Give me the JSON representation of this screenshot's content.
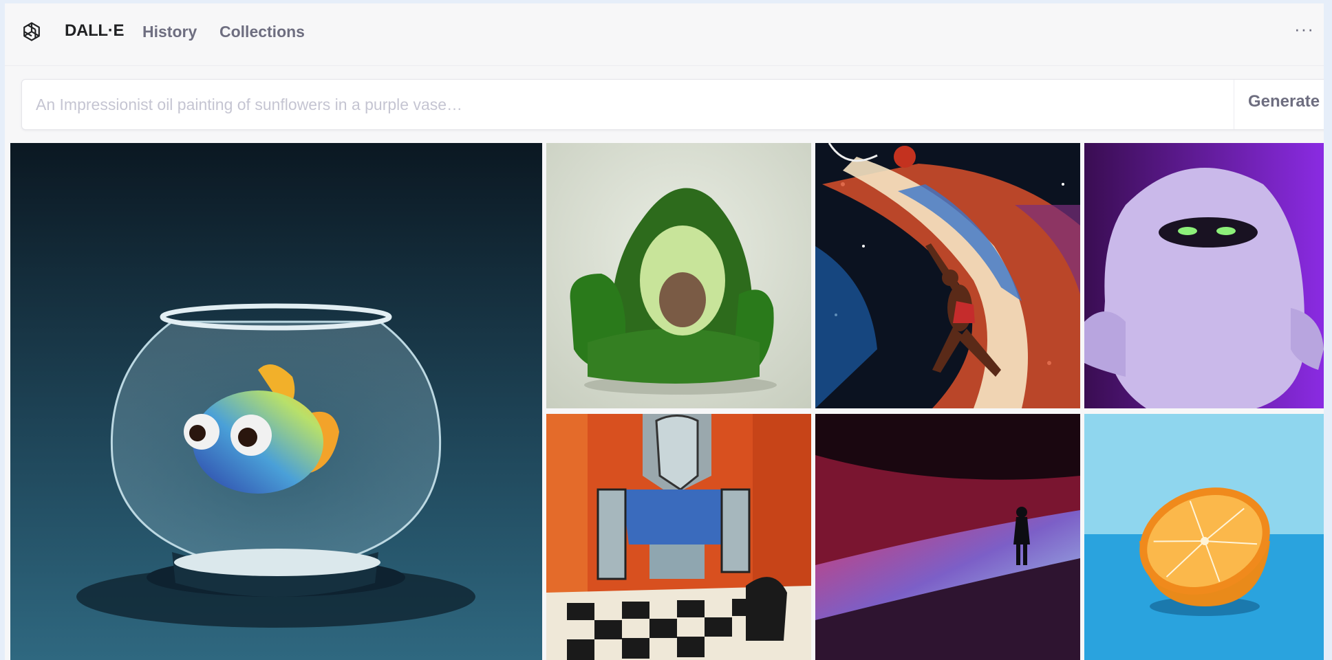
{
  "header": {
    "brand": "DALL·E",
    "nav": [
      {
        "label": "History"
      },
      {
        "label": "Collections"
      }
    ],
    "more_icon": "ellipsis-icon"
  },
  "prompt": {
    "placeholder": "An Impressionist oil painting of sunflowers in a purple vase…",
    "value": "",
    "button_label": "Generate"
  },
  "gallery": [
    {
      "name": "fishbowl-image",
      "subject": "cartoon fish in a glass bowl"
    },
    {
      "name": "avocado-chair-image",
      "subject": "avocado armchair"
    },
    {
      "name": "space-basketball-image",
      "subject": "basketball player dunking in space painting"
    },
    {
      "name": "purple-monster-image",
      "subject": "furry purple monster"
    },
    {
      "name": "robot-chess-image",
      "subject": "robot playing chess painting"
    },
    {
      "name": "desert-figure-image",
      "subject": "figure on neon dune"
    },
    {
      "name": "orange-image",
      "subject": "half orange on blue"
    }
  ]
}
